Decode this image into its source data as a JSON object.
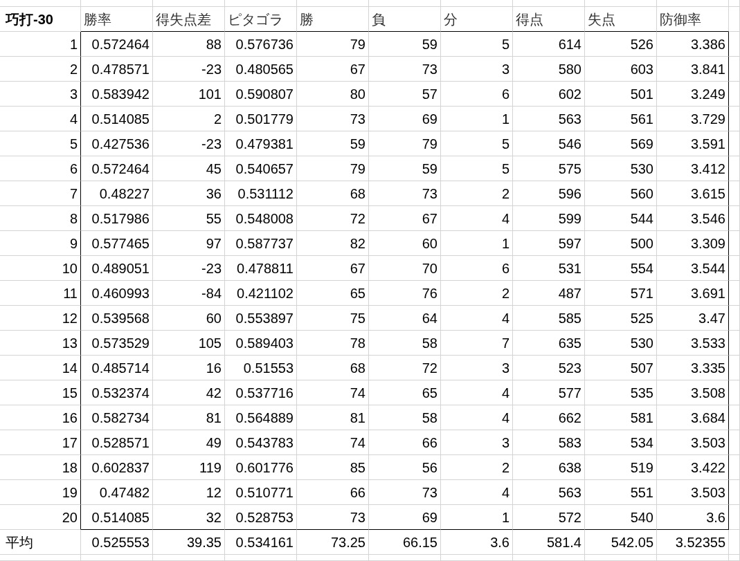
{
  "table": {
    "corner": "巧打-30",
    "columns": [
      "勝率",
      "得失点差",
      "ピタゴラ",
      "勝",
      "負",
      "分",
      "得点",
      "失点",
      "防御率"
    ],
    "rows": [
      {
        "label": "1",
        "cells": [
          "0.572464",
          "88",
          "0.576736",
          "79",
          "59",
          "5",
          "614",
          "526",
          "3.386"
        ]
      },
      {
        "label": "2",
        "cells": [
          "0.478571",
          "-23",
          "0.480565",
          "67",
          "73",
          "3",
          "580",
          "603",
          "3.841"
        ]
      },
      {
        "label": "3",
        "cells": [
          "0.583942",
          "101",
          "0.590807",
          "80",
          "57",
          "6",
          "602",
          "501",
          "3.249"
        ]
      },
      {
        "label": "4",
        "cells": [
          "0.514085",
          "2",
          "0.501779",
          "73",
          "69",
          "1",
          "563",
          "561",
          "3.729"
        ]
      },
      {
        "label": "5",
        "cells": [
          "0.427536",
          "-23",
          "0.479381",
          "59",
          "79",
          "5",
          "546",
          "569",
          "3.591"
        ]
      },
      {
        "label": "6",
        "cells": [
          "0.572464",
          "45",
          "0.540657",
          "79",
          "59",
          "5",
          "575",
          "530",
          "3.412"
        ]
      },
      {
        "label": "7",
        "cells": [
          "0.48227",
          "36",
          "0.531112",
          "68",
          "73",
          "2",
          "596",
          "560",
          "3.615"
        ]
      },
      {
        "label": "8",
        "cells": [
          "0.517986",
          "55",
          "0.548008",
          "72",
          "67",
          "4",
          "599",
          "544",
          "3.546"
        ]
      },
      {
        "label": "9",
        "cells": [
          "0.577465",
          "97",
          "0.587737",
          "82",
          "60",
          "1",
          "597",
          "500",
          "3.309"
        ]
      },
      {
        "label": "10",
        "cells": [
          "0.489051",
          "-23",
          "0.478811",
          "67",
          "70",
          "6",
          "531",
          "554",
          "3.544"
        ]
      },
      {
        "label": "11",
        "cells": [
          "0.460993",
          "-84",
          "0.421102",
          "65",
          "76",
          "2",
          "487",
          "571",
          "3.691"
        ]
      },
      {
        "label": "12",
        "cells": [
          "0.539568",
          "60",
          "0.553897",
          "75",
          "64",
          "4",
          "585",
          "525",
          "3.47"
        ]
      },
      {
        "label": "13",
        "cells": [
          "0.573529",
          "105",
          "0.589403",
          "78",
          "58",
          "7",
          "635",
          "530",
          "3.533"
        ]
      },
      {
        "label": "14",
        "cells": [
          "0.485714",
          "16",
          "0.51553",
          "68",
          "72",
          "3",
          "523",
          "507",
          "3.335"
        ]
      },
      {
        "label": "15",
        "cells": [
          "0.532374",
          "42",
          "0.537716",
          "74",
          "65",
          "4",
          "577",
          "535",
          "3.508"
        ]
      },
      {
        "label": "16",
        "cells": [
          "0.582734",
          "81",
          "0.564889",
          "81",
          "58",
          "4",
          "662",
          "581",
          "3.684"
        ]
      },
      {
        "label": "17",
        "cells": [
          "0.528571",
          "49",
          "0.543783",
          "74",
          "66",
          "3",
          "583",
          "534",
          "3.503"
        ]
      },
      {
        "label": "18",
        "cells": [
          "0.602837",
          "119",
          "0.601776",
          "85",
          "56",
          "2",
          "638",
          "519",
          "3.422"
        ]
      },
      {
        "label": "19",
        "cells": [
          "0.47482",
          "12",
          "0.510771",
          "66",
          "73",
          "4",
          "563",
          "551",
          "3.503"
        ]
      },
      {
        "label": "20",
        "cells": [
          "0.514085",
          "32",
          "0.528753",
          "73",
          "69",
          "1",
          "572",
          "540",
          "3.6"
        ]
      }
    ],
    "footer": {
      "label": "平均",
      "cells": [
        "0.525553",
        "39.35",
        "0.534161",
        "73.25",
        "66.15",
        "3.6",
        "581.4",
        "542.05",
        "3.52355"
      ]
    }
  }
}
